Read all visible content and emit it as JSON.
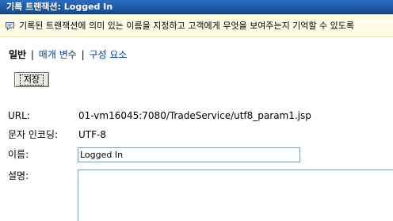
{
  "window": {
    "title": "기록 트랜잭션: Logged In"
  },
  "info": {
    "icon": "speech-bubble-icon",
    "text": "기록된 트랜잭션에 의미 있는 이름을 지정하고 고객에게 무엇을 보여주는지 기억할 수 있도록"
  },
  "tabs": [
    {
      "label": "일반",
      "active": true
    },
    {
      "label": "매개 변수",
      "active": false
    },
    {
      "label": "구성 요소",
      "active": false
    }
  ],
  "tab_separator": "|",
  "actions": {
    "save_label": "저장"
  },
  "form": {
    "url_label": "URL:",
    "url_value": "01-vm16045:7080/TradeService/utf8_param1.jsp",
    "encoding_label": "문자 인코딩:",
    "encoding_value": "UTF-8",
    "name_label": "이름:",
    "name_value": "Logged In",
    "description_label": "설명:",
    "description_value": ""
  },
  "colors": {
    "titlebar": "#1f5aa8",
    "infobar": "#fffde6",
    "link": "#003f9e"
  }
}
